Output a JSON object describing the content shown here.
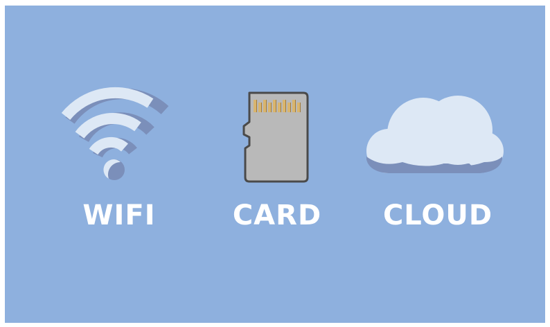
{
  "options": [
    {
      "label": "WIFI",
      "icon": "wifi-icon"
    },
    {
      "label": "CARD",
      "icon": "sd-card-icon"
    },
    {
      "label": "CLOUD",
      "icon": "cloud-icon"
    }
  ],
  "colors": {
    "background": "#8eb0de",
    "icon_light": "#dde8f5",
    "icon_shadow": "#7b8fba",
    "card_body": "#b9b9b9",
    "card_outline": "#4a4a4a",
    "card_contacts": "#d9b56e",
    "label": "#ffffff"
  }
}
